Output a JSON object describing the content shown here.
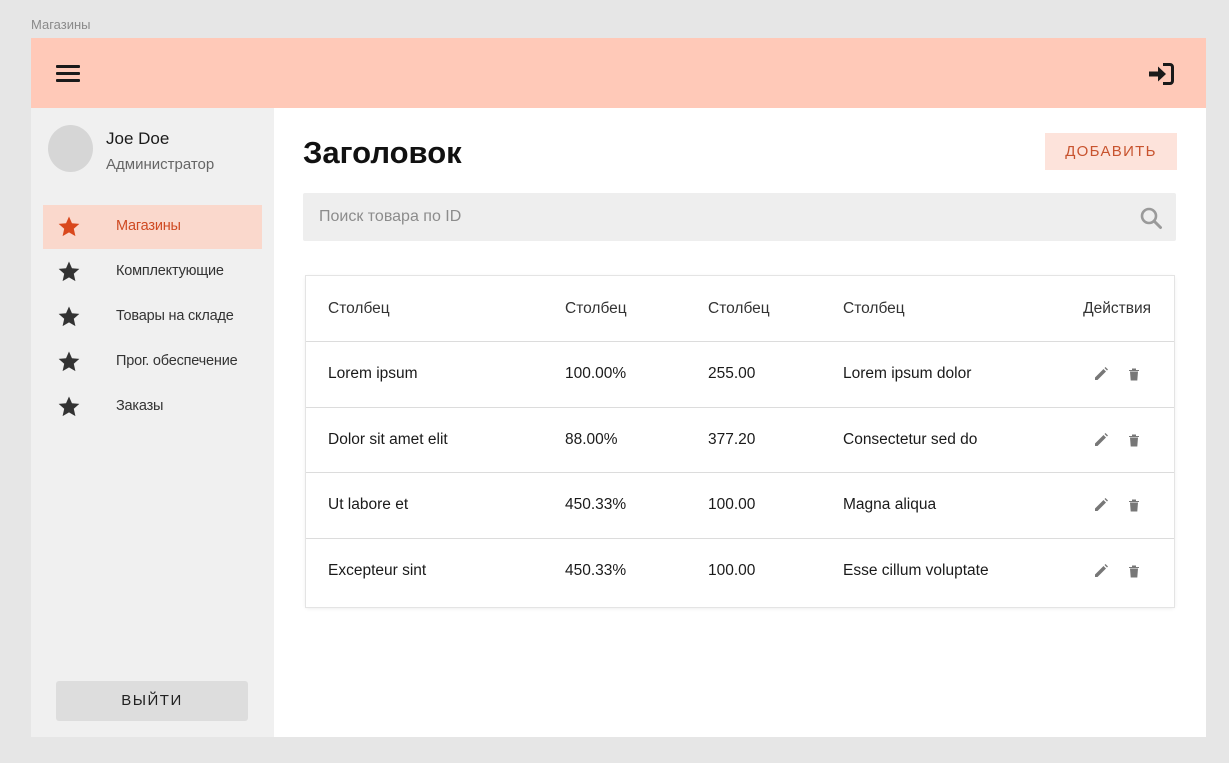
{
  "page_label": "Магазины",
  "colors": {
    "topbar": "#ffc9b8",
    "accent": "#cf4a22",
    "active_nav_bg": "#fad8cc",
    "add_button_bg": "#fde3db"
  },
  "header": {
    "menu_icon": "hamburger-menu-icon",
    "login_icon": "sign-in-icon"
  },
  "user": {
    "name": "Joe Doe",
    "role": "Администратор"
  },
  "sidebar": {
    "items": [
      {
        "label": "Магазины",
        "icon": "star-icon",
        "active": true
      },
      {
        "label": "Комплектующие",
        "icon": "star-icon",
        "active": false
      },
      {
        "label": "Товары на складе",
        "icon": "star-icon",
        "active": false
      },
      {
        "label": "Прог. обеспечение",
        "icon": "star-icon",
        "active": false
      },
      {
        "label": "Заказы",
        "icon": "star-icon",
        "active": false
      }
    ],
    "logout_label": "ВЫЙТИ"
  },
  "main": {
    "title": "Заголовок",
    "add_label": "ДОБАВИТЬ",
    "search_placeholder": "Поиск товара по ID",
    "search_value": ""
  },
  "table": {
    "columns": [
      "Столбец",
      "Столбец",
      "Столбец",
      "Столбец",
      "Действия"
    ],
    "rows": [
      [
        "Lorem ipsum",
        "100.00%",
        "255.00",
        "Lorem ipsum dolor"
      ],
      [
        "Dolor sit amet elit",
        "88.00%",
        "377.20",
        "Consectetur sed do"
      ],
      [
        "Ut labore et",
        "450.33%",
        "100.00",
        "Magna aliqua"
      ],
      [
        "Excepteur sint",
        "450.33%",
        "100.00",
        "Esse cillum voluptate"
      ]
    ],
    "row_actions": [
      "edit-icon",
      "trash-icon"
    ]
  }
}
